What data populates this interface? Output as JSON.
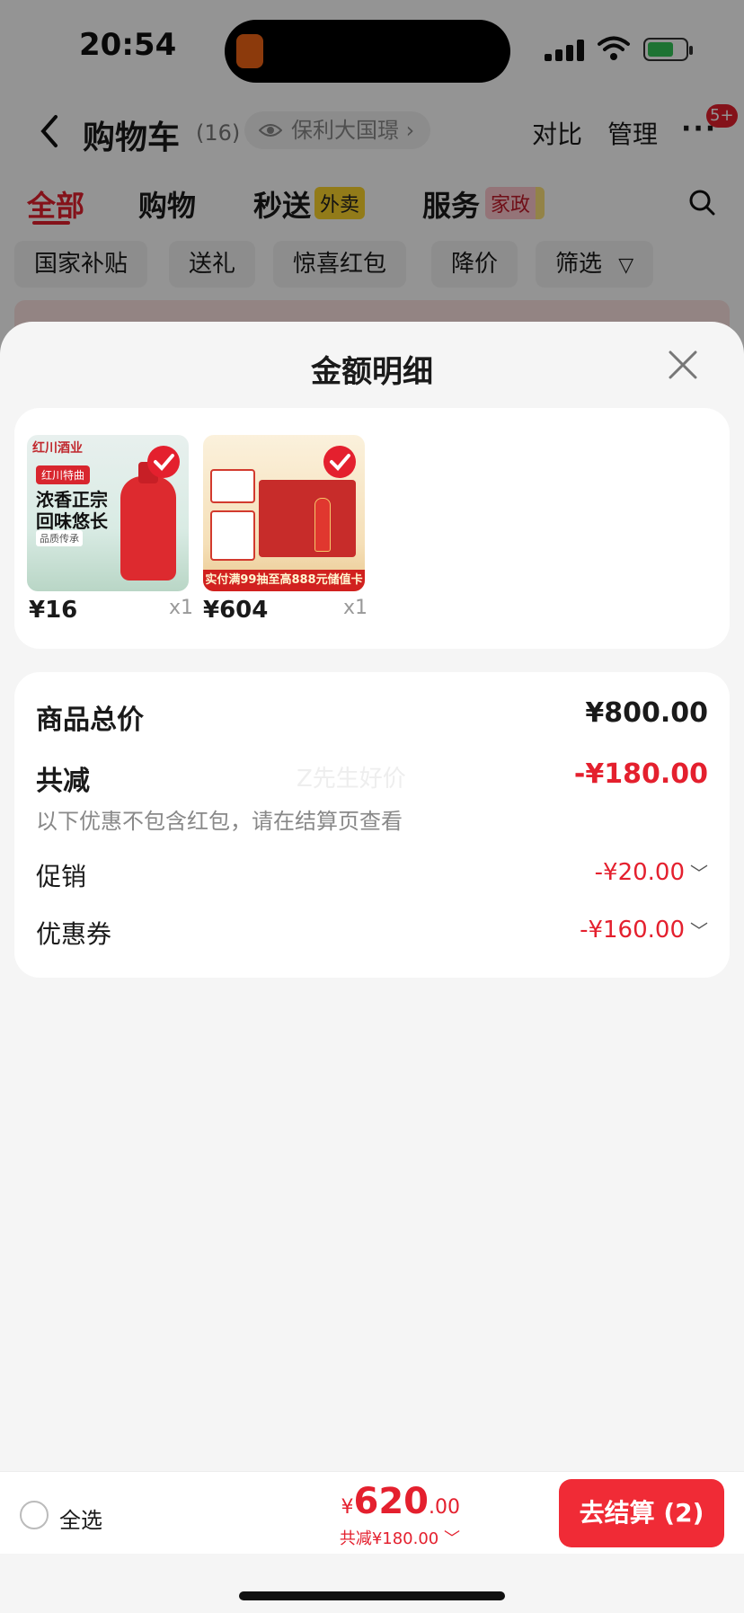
{
  "status_bar": {
    "time": "20:54"
  },
  "header": {
    "title": "购物车",
    "count": "(16)",
    "location": "保利大国璟",
    "location_chevron": "›",
    "compare": "对比",
    "manage": "管理",
    "more": "···",
    "badge": "5+"
  },
  "tabs": [
    {
      "label": "全部"
    },
    {
      "label": "购物"
    },
    {
      "label": "秒送",
      "tag": "外卖"
    },
    {
      "label": "服务",
      "tag": "家政"
    }
  ],
  "filters": [
    "国家补贴",
    "送礼",
    "惊喜红包",
    "降价",
    "筛选"
  ],
  "sheet": {
    "title": "金额明细",
    "items": [
      {
        "price": "¥16",
        "qty": "x1",
        "brand": "红川酒业",
        "tag": "红川特曲",
        "line1": "浓香正宗",
        "line2": "回味悠长",
        "caption": "品质传承"
      },
      {
        "price": "¥604",
        "qty": "x1",
        "banner": "实付满99抽至高888元储值卡"
      }
    ],
    "summary": {
      "total_label": "商品总价",
      "total_value": "¥800.00",
      "reduce_label": "共减",
      "reduce_value": "-¥180.00",
      "note": "以下优惠不包含红包，请在结算页查看",
      "promo_label": "促销",
      "promo_value": "-¥20.00",
      "coupon_label": "优惠券",
      "coupon_value": "-¥160.00",
      "watermark": "Z先生好价"
    }
  },
  "bottom_bar": {
    "select_all": "全选",
    "currency": "¥",
    "total_int": "620",
    "total_dec": ".00",
    "saved": "共减¥180.00",
    "checkout": "去结算 (2)"
  },
  "colors": {
    "accent": "#e4202e",
    "button": "#f02b36",
    "sheet_bg": "#f5f5f5"
  }
}
